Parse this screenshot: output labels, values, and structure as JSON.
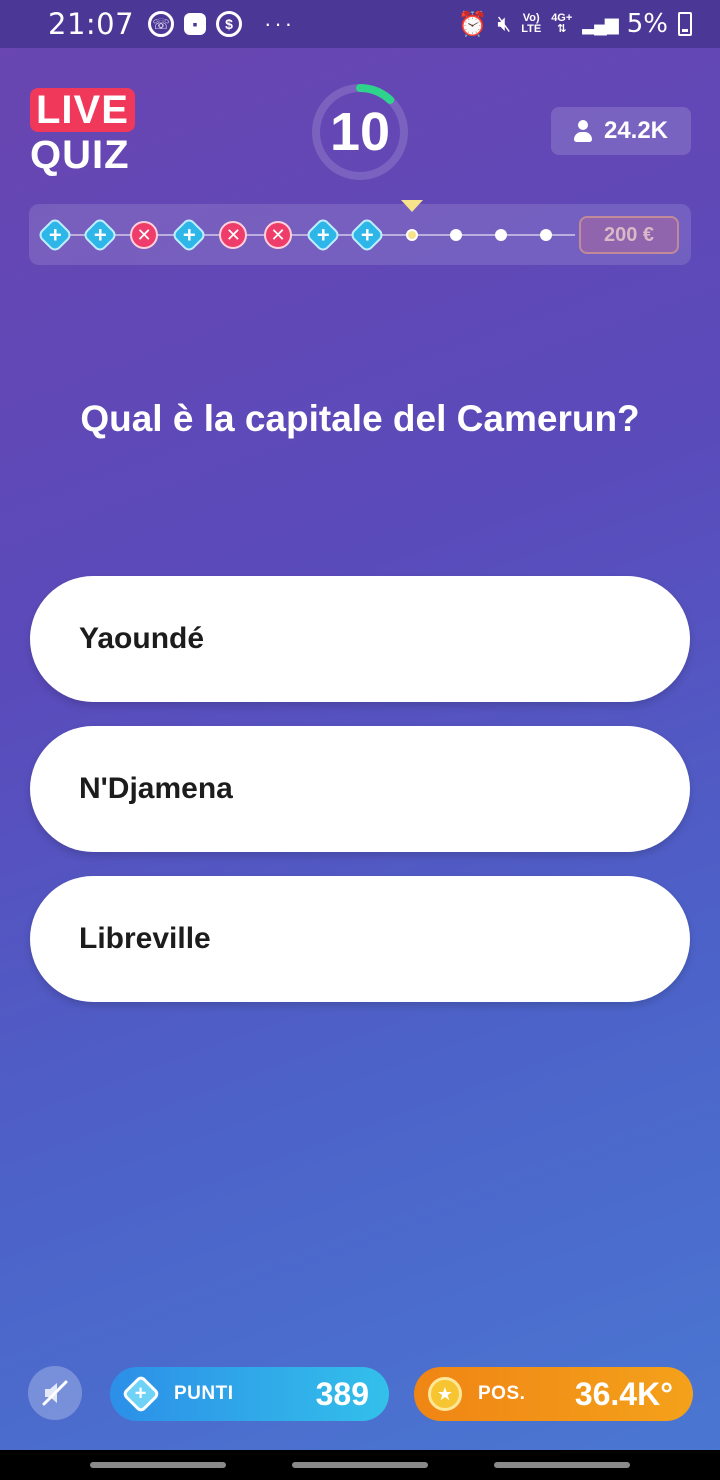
{
  "status_bar": {
    "time": "21:07",
    "left_icons": [
      "whatsapp-icon",
      "game-icon",
      "dollar-icon"
    ],
    "more": "···",
    "network_top": "Vo)",
    "network_bottom": "LTE",
    "data_top": "4G+",
    "battery": "5%"
  },
  "header": {
    "logo_top": "LIVE",
    "logo_bottom": "QUIZ",
    "timer": "10",
    "timer_progress": 0.12,
    "viewers": "24.2K"
  },
  "progress": {
    "results": [
      "correct",
      "correct",
      "wrong",
      "correct",
      "wrong",
      "wrong",
      "correct",
      "correct",
      "current",
      "pending",
      "pending",
      "pending"
    ],
    "prize": "200 €"
  },
  "question": "Qual è la capitale del Camerun?",
  "answers": [
    {
      "label": "Yaoundé"
    },
    {
      "label": "N'Djamena"
    },
    {
      "label": "Libreville"
    }
  ],
  "bottom": {
    "points_label": "PUNTI",
    "points_value": "389",
    "pos_label": "POS.",
    "pos_value": "36.4K°"
  },
  "colors": {
    "accent_live": "#f0385b",
    "correct": "#2fb6e8",
    "wrong": "#ee3d6a",
    "timer_ring": "#2fd48c"
  }
}
